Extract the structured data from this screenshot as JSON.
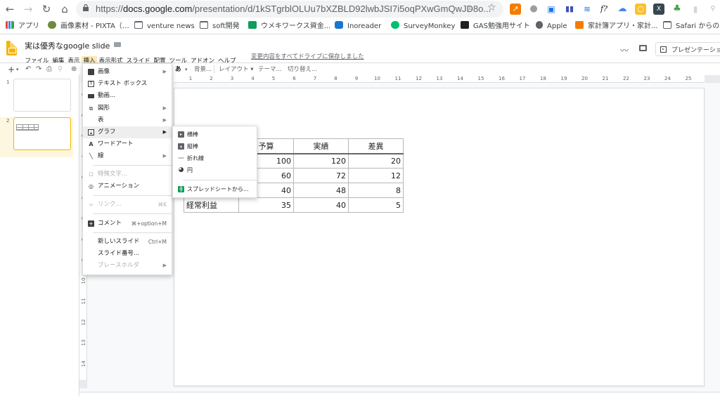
{
  "browser": {
    "url_host": "docs.google.com",
    "url_prefix": "https://",
    "url_path": "/presentation/d/1kSTgrblOLUu7bXZBLD92lwbJSI7i5oqPXwGmQwJD8o...",
    "nav_icons": [
      "back-arrow-icon",
      "forward-arrow-icon",
      "reload-icon",
      "home-icon"
    ],
    "extension_icons": [
      "analytics-icon",
      "circle-icon",
      "feedly-icon",
      "bar-chart-icon",
      "lines-icon",
      "formula-icon",
      "cloud-icon",
      "sun-icon",
      "x-icon",
      "clover-icon",
      "doc-icon",
      "people-icon"
    ]
  },
  "bookmarks": [
    {
      "label": "アプリ",
      "icon": "apps-grid-icon"
    },
    {
      "label": "画像素材 - PIXTA（…",
      "icon": "pixta-icon"
    },
    {
      "label": "venture news",
      "icon": "folder-icon"
    },
    {
      "label": "soft開発",
      "icon": "folder-icon"
    },
    {
      "label": "ウメキワークス資金...",
      "icon": "sheets-icon"
    },
    {
      "label": "Inoreader",
      "icon": "inoreader-icon"
    },
    {
      "label": "SurveyMonkey",
      "icon": "surveymonkey-icon"
    },
    {
      "label": "GAS勉強用サイト",
      "icon": "qr-icon"
    },
    {
      "label": "Apple",
      "icon": "apple-icon"
    },
    {
      "label": "家計簿アプリ・家計...",
      "icon": "kakeibo-icon"
    },
    {
      "label": "Safari からのイ",
      "icon": "folder-icon"
    }
  ],
  "document": {
    "title": "実は優秀なgoogle slide",
    "save_status": "変更内容をすべてドライブに保存しました",
    "present_label": "プレゼンテーション"
  },
  "menus": [
    {
      "label": "ファイル"
    },
    {
      "label": "編集"
    },
    {
      "label": "表示"
    },
    {
      "label": "挿入",
      "active": true
    },
    {
      "label": "表示形式"
    },
    {
      "label": "スライド"
    },
    {
      "label": "配置"
    },
    {
      "label": "ツール"
    },
    {
      "label": "アドオン"
    },
    {
      "label": "ヘルプ"
    }
  ],
  "toolbar": {
    "input_tool": "あ",
    "background": "背景...",
    "layout": "レイアウト",
    "theme": "テーマ...",
    "transition": "切り替え..."
  },
  "ruler": {
    "horizontal": [
      "1",
      "2",
      "3",
      "4",
      "5",
      "6",
      "7",
      "8",
      "9",
      "10",
      "11",
      "12",
      "13",
      "14",
      "15",
      "16",
      "17",
      "18",
      "19",
      "20",
      "21",
      "22",
      "23",
      "24",
      "25"
    ],
    "vertical": [
      "1",
      "2",
      "3",
      "4",
      "5",
      "6",
      "7",
      "8",
      "9",
      "10",
      "11",
      "12",
      "13",
      "14"
    ]
  },
  "slides": [
    {
      "number": "1"
    },
    {
      "number": "2",
      "selected": true
    }
  ],
  "insert_menu": {
    "items": [
      {
        "label": "画像",
        "icon": "image-icon",
        "submenu": true
      },
      {
        "label": "テキスト ボックス",
        "icon": "textbox-icon"
      },
      {
        "label": "動画...",
        "icon": "video-icon"
      },
      {
        "label": "図形",
        "icon": "shapes-icon",
        "submenu": true
      },
      {
        "label": "表",
        "icon": "",
        "submenu": true
      },
      {
        "label": "グラフ",
        "icon": "chart-icon",
        "submenu": true,
        "highlighted": true
      },
      {
        "label": "ワードアート",
        "icon": "wordart-icon"
      },
      {
        "label": "線",
        "icon": "line-icon",
        "submenu": true
      },
      {
        "label": "特殊文字...",
        "icon": "omega-icon",
        "disabled": true
      },
      {
        "label": "アニメーション",
        "icon": "animation-icon"
      },
      {
        "label": "リンク...",
        "icon": "link-icon",
        "shortcut": "⌘K",
        "disabled": true
      },
      {
        "label": "コメント",
        "icon": "comment-add-icon",
        "shortcut": "⌘+option+M"
      },
      {
        "label": "新しいスライド",
        "shortcut": "Ctrl+M"
      },
      {
        "label": "スライド番号..."
      },
      {
        "label": "プレースホルダ",
        "submenu": true,
        "disabled": true
      }
    ]
  },
  "graph_submenu": {
    "items": [
      {
        "label": "横棒",
        "icon": "bar-chart-icon"
      },
      {
        "label": "縦棒",
        "icon": "column-chart-icon"
      },
      {
        "label": "折れ線",
        "icon": "line-chart-icon"
      },
      {
        "label": "円",
        "icon": "pie-chart-icon"
      },
      {
        "label": "スプレッドシートから...",
        "icon": "sheets-icon"
      }
    ]
  },
  "slide_table": {
    "headers": [
      "",
      "予算",
      "実績",
      "差異"
    ],
    "rows": [
      [
        "",
        "100",
        "120",
        "20"
      ],
      [
        "",
        "60",
        "72",
        "12"
      ],
      [
        "",
        "40",
        "48",
        "8"
      ],
      [
        "経常利益",
        "35",
        "40",
        "5"
      ]
    ]
  }
}
